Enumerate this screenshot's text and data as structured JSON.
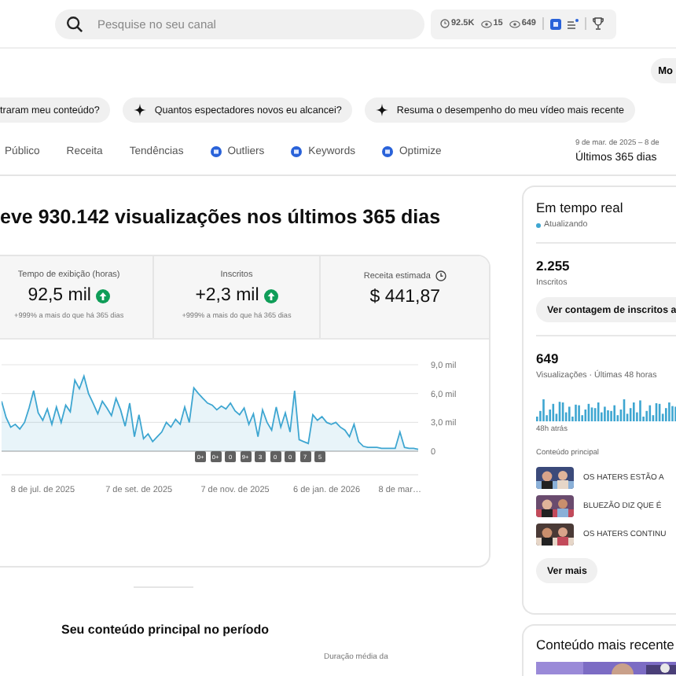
{
  "search": {
    "placeholder": "Pesquise no seu canal"
  },
  "header_stats": [
    {
      "kind": "clock",
      "text": "92.5K"
    },
    {
      "kind": "eye",
      "text": "15"
    },
    {
      "kind": "eye",
      "text": "649"
    }
  ],
  "top_button": "Mo",
  "suggestions": [
    "traram meu conteúdo?",
    "Quantos espectadores novos eu alcancei?",
    "Resuma o desempenho do meu vídeo mais recente"
  ],
  "tabs": [
    {
      "label": "Público",
      "kind": "plain",
      "selected": false
    },
    {
      "label": "Receita",
      "kind": "plain",
      "selected": false
    },
    {
      "label": "Tendências",
      "kind": "plain",
      "selected": false
    },
    {
      "label": "Outliers",
      "kind": "badge",
      "selected": false
    },
    {
      "label": "Keywords",
      "kind": "badge",
      "selected": false
    },
    {
      "label": "Optimize",
      "kind": "badge",
      "selected": false
    }
  ],
  "date_range": {
    "range": "9 de mar. de 2025 – 8 de",
    "label": "Últimos 365 dias"
  },
  "heading": "eve 930.142 visualizações nos últimos 365 dias",
  "metrics": [
    {
      "label": "Tempo de exibição (horas)",
      "value": "92,5 mil",
      "increase": true,
      "comparison": "+999% a mais do que há 365 dias"
    },
    {
      "label": "Inscritos",
      "value": "+2,3 mil",
      "increase": true,
      "comparison": "+999% a mais do que há 365 dias"
    },
    {
      "label": "Receita estimada",
      "value": "$ 441,87",
      "info": true
    }
  ],
  "chart": {
    "chart_data": {
      "type": "area",
      "categories": [
        null,
        null,
        null,
        null,
        null,
        null,
        null,
        null,
        null,
        "8 de jul. de 2025",
        null,
        null,
        null,
        null,
        null,
        null,
        null,
        null,
        null,
        null,
        null,
        null,
        null,
        null,
        null,
        null,
        null,
        null,
        null,
        null,
        "7 de set. de 2025",
        null,
        null,
        null,
        null,
        null,
        null,
        null,
        null,
        null,
        null,
        null,
        null,
        null,
        null,
        null,
        null,
        null,
        null,
        null,
        null,
        "7 de nov. de 2025",
        null,
        null,
        null,
        null,
        null,
        null,
        null,
        null,
        null,
        null,
        null,
        null,
        null,
        null,
        null,
        null,
        null,
        null,
        null,
        "6 de jan. de 2026",
        null,
        null,
        null,
        null,
        null,
        null,
        null,
        null,
        null,
        null,
        null,
        null,
        null,
        null,
        null,
        "8 de mar…",
        null,
        null,
        null,
        null
      ],
      "values": [
        5.2,
        3.5,
        2.5,
        2.8,
        2.3,
        3.0,
        4.5,
        6.3,
        4.0,
        3.2,
        4.4,
        2.8,
        4.6,
        3.0,
        4.8,
        4.1,
        7.4,
        6.5,
        7.8,
        6.0,
        5.0,
        3.9,
        5.2,
        4.5,
        3.7,
        5.5,
        4.3,
        2.6,
        5.0,
        1.5,
        3.8,
        1.3,
        1.8,
        1.0,
        1.5,
        2.0,
        3.0,
        2.5,
        3.3,
        2.8,
        4.6,
        3.0,
        6.6,
        6.0,
        5.5,
        5.0,
        4.8,
        4.3,
        4.7,
        4.4,
        5.0,
        4.2,
        3.8,
        4.5,
        2.8,
        3.9,
        1.5,
        4.3,
        3.0,
        2.2,
        4.6,
        2.5,
        4.0,
        2.0,
        6.3,
        1.2,
        1.0,
        0.8,
        3.8,
        3.2,
        3.6,
        3.0,
        2.8,
        3.0,
        2.5,
        2.2,
        1.5,
        2.8,
        1.0,
        0.5,
        0.4,
        0.4,
        0.4,
        0.3,
        0.3,
        0.3,
        0.3,
        2.0,
        0.4,
        0.3,
        0.3,
        0.2
      ],
      "ylim": [
        0,
        9
      ],
      "yticks": [
        {
          "value": 0,
          "label": "0"
        },
        {
          "value": 3,
          "label": "3,0 mil"
        },
        {
          "value": 6,
          "label": "6,0 mil"
        },
        {
          "value": 9,
          "label": "9,0 mil"
        }
      ],
      "stacked": false
    },
    "milestones": [
      "0+",
      "0+",
      "0",
      "9+",
      "3",
      "0",
      "0",
      "7",
      "5"
    ]
  },
  "section_title": "Seu conteúdo principal no período",
  "column_header": "Duração média da",
  "realtime": {
    "title": "Em tempo real",
    "status": "Atualizando",
    "subscribers": "2.255",
    "subscribers_label": "Inscritos",
    "count_button": "Ver contagem de inscritos a",
    "views": "649",
    "views_label": "Visualizações · Últimas 48 horas",
    "axis_label": "48h atrás",
    "top_label": "Conteúdo principal",
    "videos": [
      {
        "title": "OS HATERS ESTÃO A"
      },
      {
        "title": "BLUEZÃO DIZ QUE É"
      },
      {
        "title": "OS HATERS CONTINU"
      }
    ],
    "more_button": "Ver mais"
  },
  "latest": {
    "title": "Conteúdo mais recente"
  }
}
